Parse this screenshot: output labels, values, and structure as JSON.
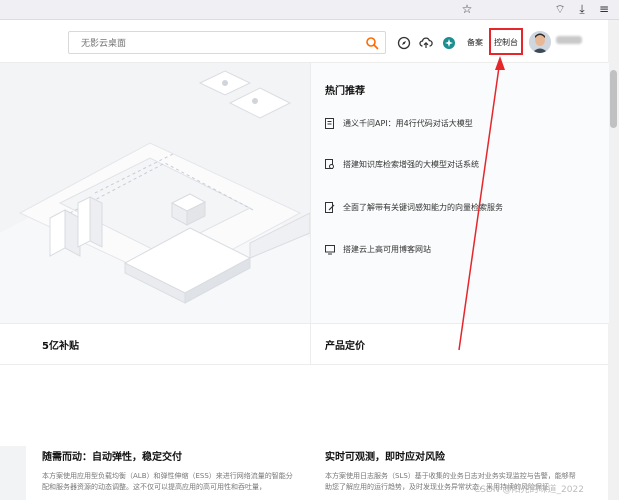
{
  "search": {
    "placeholder": "无影云桌面"
  },
  "nav": {
    "filing_label": "备案",
    "console_label": "控制台"
  },
  "hot": {
    "title": "热门推荐",
    "items": [
      {
        "label": "通义千问API：用4行代码对话大模型",
        "icon": "document-icon"
      },
      {
        "label": "搭建知识库检索增强的大模型对话系统",
        "icon": "search-document-icon"
      },
      {
        "label": "全面了解带有关键词感知能力的向量检索服务",
        "icon": "edit-document-icon"
      },
      {
        "label": "搭建云上高可用博客网站",
        "icon": "monitor-icon"
      }
    ]
  },
  "cards": {
    "subsidy": "5亿补贴",
    "pricing": "产品定价"
  },
  "features": [
    {
      "title": "随需而动：自动弹性，稳定交付",
      "desc": "本方案使用应用型负载均衡（ALB）和弹性伸缩（ESS）来进行网络流量的智能分配和服务器资源的动态调整。这不仅可以提高应用的高可用性和吞吐量，"
    },
    {
      "title": "实时可观测，即时应对风险",
      "desc": "本方案使用日志服务（SLS）基于收集的业务日志对业务实现监控与告警，能够帮助您了解应用的运行趋势，及时发现业务异常状态，采用持续的风险保证"
    }
  ],
  "watermark": "CSDN @阳光的味道_2022",
  "colors": {
    "highlight_box": "#e5262b",
    "arrow": "#e5262b",
    "search_icon": "#ff6a00"
  }
}
